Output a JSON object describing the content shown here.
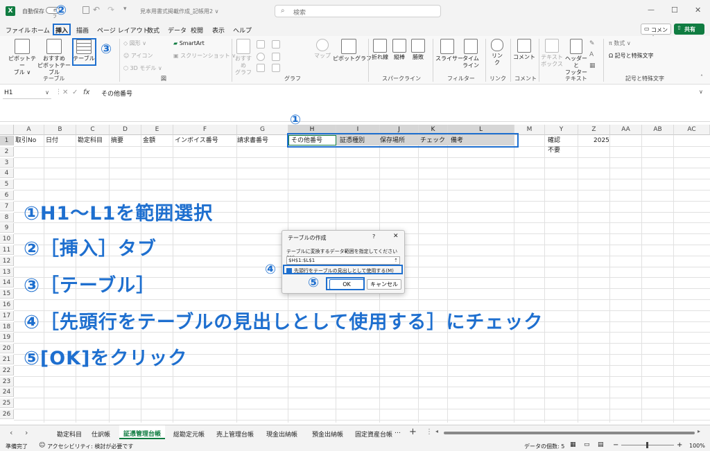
{
  "titlebar": {
    "autosave_label": "自動保存",
    "autosave_state": "オフ",
    "doc_title": "見本用書式掲載作成_記帳用2 ∨",
    "search_placeholder": "検索",
    "min": "—",
    "max": "☐",
    "close": "✕"
  },
  "menu": {
    "items": [
      "ファイル",
      "ホーム",
      "挿入",
      "描画",
      "ページ レイアウト",
      "数式",
      "データ",
      "校閲",
      "表示",
      "ヘルプ"
    ],
    "comment_button": "コメント",
    "share_button": "共有"
  },
  "ribbon": {
    "pivot_table": "ピボットテー\nブル ∨",
    "recommended_pivot": "おすすめ\nピボットテーブル",
    "table": "テーブル",
    "group_table": "テーブル",
    "shapes": "図形 ∨",
    "icons": "アイコン",
    "model3d": "3D モデル ∨",
    "smartart": "SmartArt",
    "screenshot": "スクリーンショット ∨",
    "group_figure": "図",
    "recommended_graph": "おすすめ\nグラフ",
    "map": "マップ",
    "pivot_graph": "ピボットグラフ",
    "group_graph": "グラフ",
    "sparkline_line": "折れ線",
    "sparkline_column": "縦棒",
    "sparkline_winloss": "勝敗",
    "group_sparkline": "スパークライン",
    "slicer": "スライサー",
    "timeline": "タイム\nライン",
    "group_filter": "フィルター",
    "link": "リン\nク",
    "group_link": "リンク",
    "comment": "コメント",
    "group_comment": "コメント",
    "textbox": "テキスト\nボックス",
    "header_footer": "ヘッダーと\nフッター",
    "group_text": "テキスト",
    "equation": "数式 ∨",
    "symbol": "記号と特殊文字",
    "group_symbol": "記号と特殊文字"
  },
  "formula_bar": {
    "name_box": "H1",
    "fx": "fx",
    "content": "その他番号"
  },
  "grid": {
    "columns": [
      "A",
      "B",
      "C",
      "D",
      "E",
      "F",
      "G",
      "H",
      "I",
      "J",
      "K",
      "L",
      "M",
      "Y",
      "Z",
      "AA",
      "AB",
      "AC"
    ],
    "rows": [
      "1",
      "2",
      "3",
      "4",
      "5",
      "6",
      "7",
      "8",
      "9",
      "10",
      "11",
      "12",
      "13",
      "14",
      "15",
      "16",
      "17",
      "18",
      "19",
      "20",
      "21",
      "22",
      "23",
      "24",
      "25",
      "26"
    ],
    "row1": {
      "A": "取引No",
      "B": "日付",
      "C": "勘定科目",
      "D": "摘要",
      "E": "金額",
      "F": "インボイス番号",
      "G": "請求書番号",
      "H": "その他番号",
      "I": "証憑種別",
      "J": "保存場所",
      "K": "チェック",
      "L": "備考",
      "Y": "確認",
      "Z": "2025"
    },
    "row2": {
      "Y": "不要"
    }
  },
  "annotations": {
    "circle1": "①",
    "circle2": "②",
    "circle3": "③",
    "circle4": "④",
    "circle5": "⑤",
    "line1": "①H1～L1を範囲選択",
    "line2": "②［挿入］タブ",
    "line3": "③［テーブル］",
    "line4": "④［先頭行をテーブルの見出しとして使用する］にチェック",
    "line5": "⑤[OK]をクリック"
  },
  "dialog": {
    "title": "テーブルの作成",
    "help": "?",
    "close": "✕",
    "prompt": "テーブルに変換するデータ範囲を指定してください(W)",
    "range_value": "$H$1:$L$1",
    "checkbox_label": "先頭行をテーブルの見出しとして使用する(M)",
    "ok": "OK",
    "cancel": "キャンセル"
  },
  "sheet_tabs": {
    "prev": "‹",
    "next": "›",
    "tabs": [
      "勘定科目",
      "仕訳帳",
      "証憑管理台帳",
      "総勘定元帳",
      "売上管理台帳",
      "現金出納帳",
      "預金出納帳",
      "固定資産台帳"
    ],
    "more": "…",
    "add": "+",
    "options": "⋮"
  },
  "status": {
    "ready": "準備完了",
    "accessibility": "アクセシビリティ: 検討が必要です",
    "count": "データの個数: 5",
    "zoom": "100%",
    "zoom_minus": "−",
    "zoom_plus": "+"
  },
  "colors": {
    "accent": "#1e6fcf",
    "excel_green": "#107c41"
  }
}
